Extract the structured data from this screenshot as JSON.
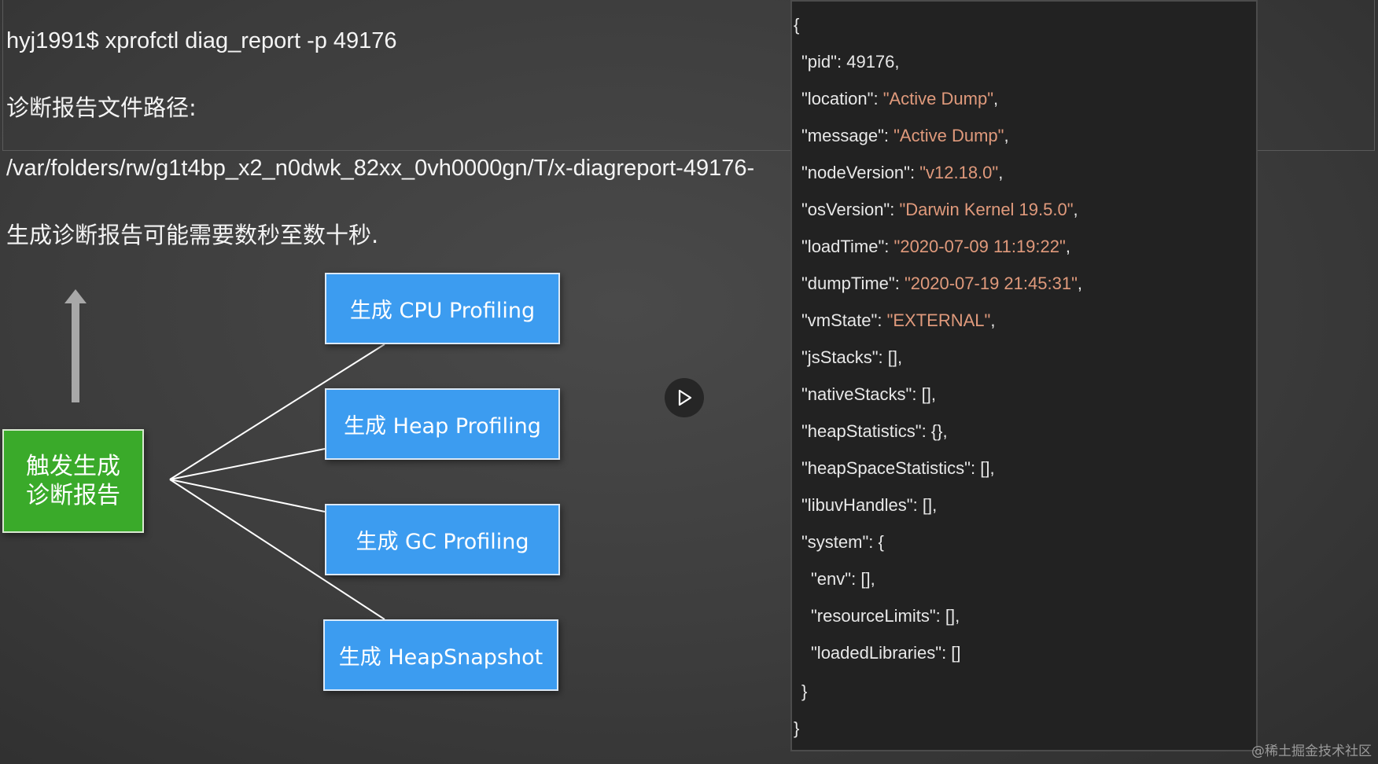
{
  "terminal": {
    "command": "hyj1991$ xprofctl diag_report -p 49176",
    "path_label": "诊断报告文件路径:",
    "path_value": "/var/folders/rw/g1t4bp_x2_n0dwk_82xx_0vh0000gn/T/x-diagreport-49176-",
    "wait_note": "生成诊断报告可能需要数秒至数十秒."
  },
  "diagram": {
    "trigger_line1": "触发生成",
    "trigger_line2": "诊断报告",
    "gen_cpu": "生成 CPU Profiling",
    "gen_heap": "生成 Heap Profiling",
    "gen_gc": "生成 GC Profiling",
    "gen_snapshot": "生成 HeapSnapshot"
  },
  "json_panel": {
    "open_brace": "{",
    "close_brace": "}",
    "system_close": "}",
    "lines": [
      {
        "key": "\"pid\"",
        "sep": ": ",
        "value": "49176",
        "is_string": false,
        "tail": ","
      },
      {
        "key": "\"location\"",
        "sep": ": ",
        "value": "\"Active Dump\"",
        "is_string": true,
        "tail": ","
      },
      {
        "key": "\"message\"",
        "sep": ": ",
        "value": "\"Active Dump\"",
        "is_string": true,
        "tail": ","
      },
      {
        "key": "\"nodeVersion\"",
        "sep": ": ",
        "value": "\"v12.18.0\"",
        "is_string": true,
        "tail": ","
      },
      {
        "key": "\"osVersion\"",
        "sep": ": ",
        "value": "\"Darwin Kernel 19.5.0\"",
        "is_string": true,
        "tail": ","
      },
      {
        "key": "\"loadTime\"",
        "sep": ": ",
        "value": "\"2020-07-09 11:19:22\"",
        "is_string": true,
        "tail": ","
      },
      {
        "key": "\"dumpTime\"",
        "sep": ": ",
        "value": "\"2020-07-19 21:45:31\"",
        "is_string": true,
        "tail": ","
      },
      {
        "key": "\"vmState\"",
        "sep": ": ",
        "value": "\"EXTERNAL\"",
        "is_string": true,
        "tail": ","
      },
      {
        "key": "\"jsStacks\"",
        "sep": ": ",
        "value": "[]",
        "is_string": false,
        "tail": ","
      },
      {
        "key": "\"nativeStacks\"",
        "sep": ": ",
        "value": "[]",
        "is_string": false,
        "tail": ","
      },
      {
        "key": "\"heapStatistics\"",
        "sep": ": ",
        "value": "{}",
        "is_string": false,
        "tail": ","
      },
      {
        "key": "\"heapSpaceStatistics\"",
        "sep": ": ",
        "value": "[]",
        "is_string": false,
        "tail": ","
      },
      {
        "key": "\"libuvHandles\"",
        "sep": ": ",
        "value": "[]",
        "is_string": false,
        "tail": ","
      },
      {
        "key": "\"system\"",
        "sep": ": ",
        "value": "{",
        "is_string": false,
        "tail": ""
      },
      {
        "key": "\"env\"",
        "sep": ": ",
        "value": "[]",
        "is_string": false,
        "tail": ","
      },
      {
        "key": "\"resourceLimits\"",
        "sep": ": ",
        "value": "[]",
        "is_string": false,
        "tail": ","
      },
      {
        "key": "\"loadedLibraries\"",
        "sep": ": ",
        "value": "[]",
        "is_string": false,
        "tail": ""
      }
    ]
  },
  "watermark": "@稀土掘金技术社区",
  "icons": {
    "play": "play-icon",
    "arrow": "up-arrow-icon"
  },
  "colors": {
    "trigger_box": "#3aaa2a",
    "gen_box": "#3c9cf0",
    "json_string": "#e09a7c",
    "panel_bg": "#222222"
  }
}
